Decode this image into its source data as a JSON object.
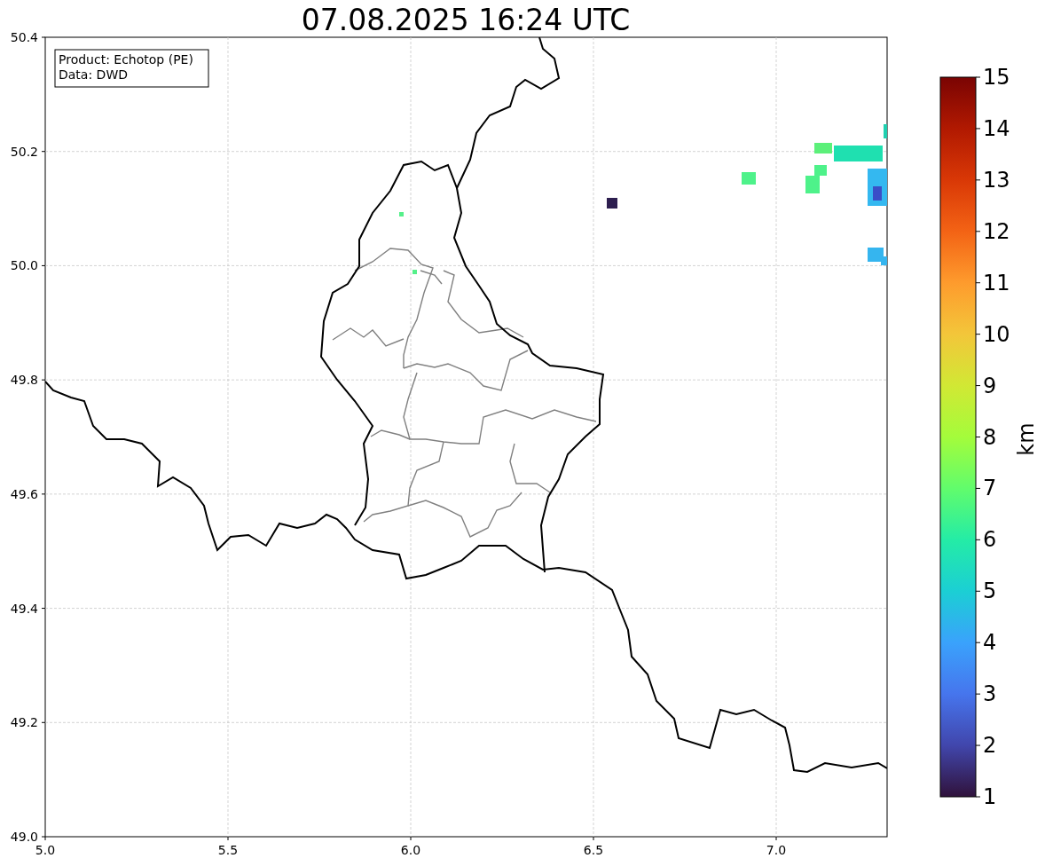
{
  "title": "07.08.2025 16:24 UTC",
  "legend": [
    "Product: Echotop (PE)",
    "Data: DWD"
  ],
  "x_axis": {
    "ticks": [
      "5.0",
      "5.5",
      "6.0",
      "6.5",
      "7.0"
    ]
  },
  "y_axis": {
    "ticks": [
      "50.4",
      "50.2",
      "50.0",
      "49.8",
      "49.6",
      "49.4",
      "49.2",
      "49.0"
    ]
  },
  "colorbar": {
    "label": "km",
    "ticks": [
      "15",
      "14",
      "13",
      "12",
      "11",
      "10",
      "9",
      "8",
      "7",
      "6",
      "5",
      "4",
      "3",
      "2",
      "1"
    ]
  }
}
